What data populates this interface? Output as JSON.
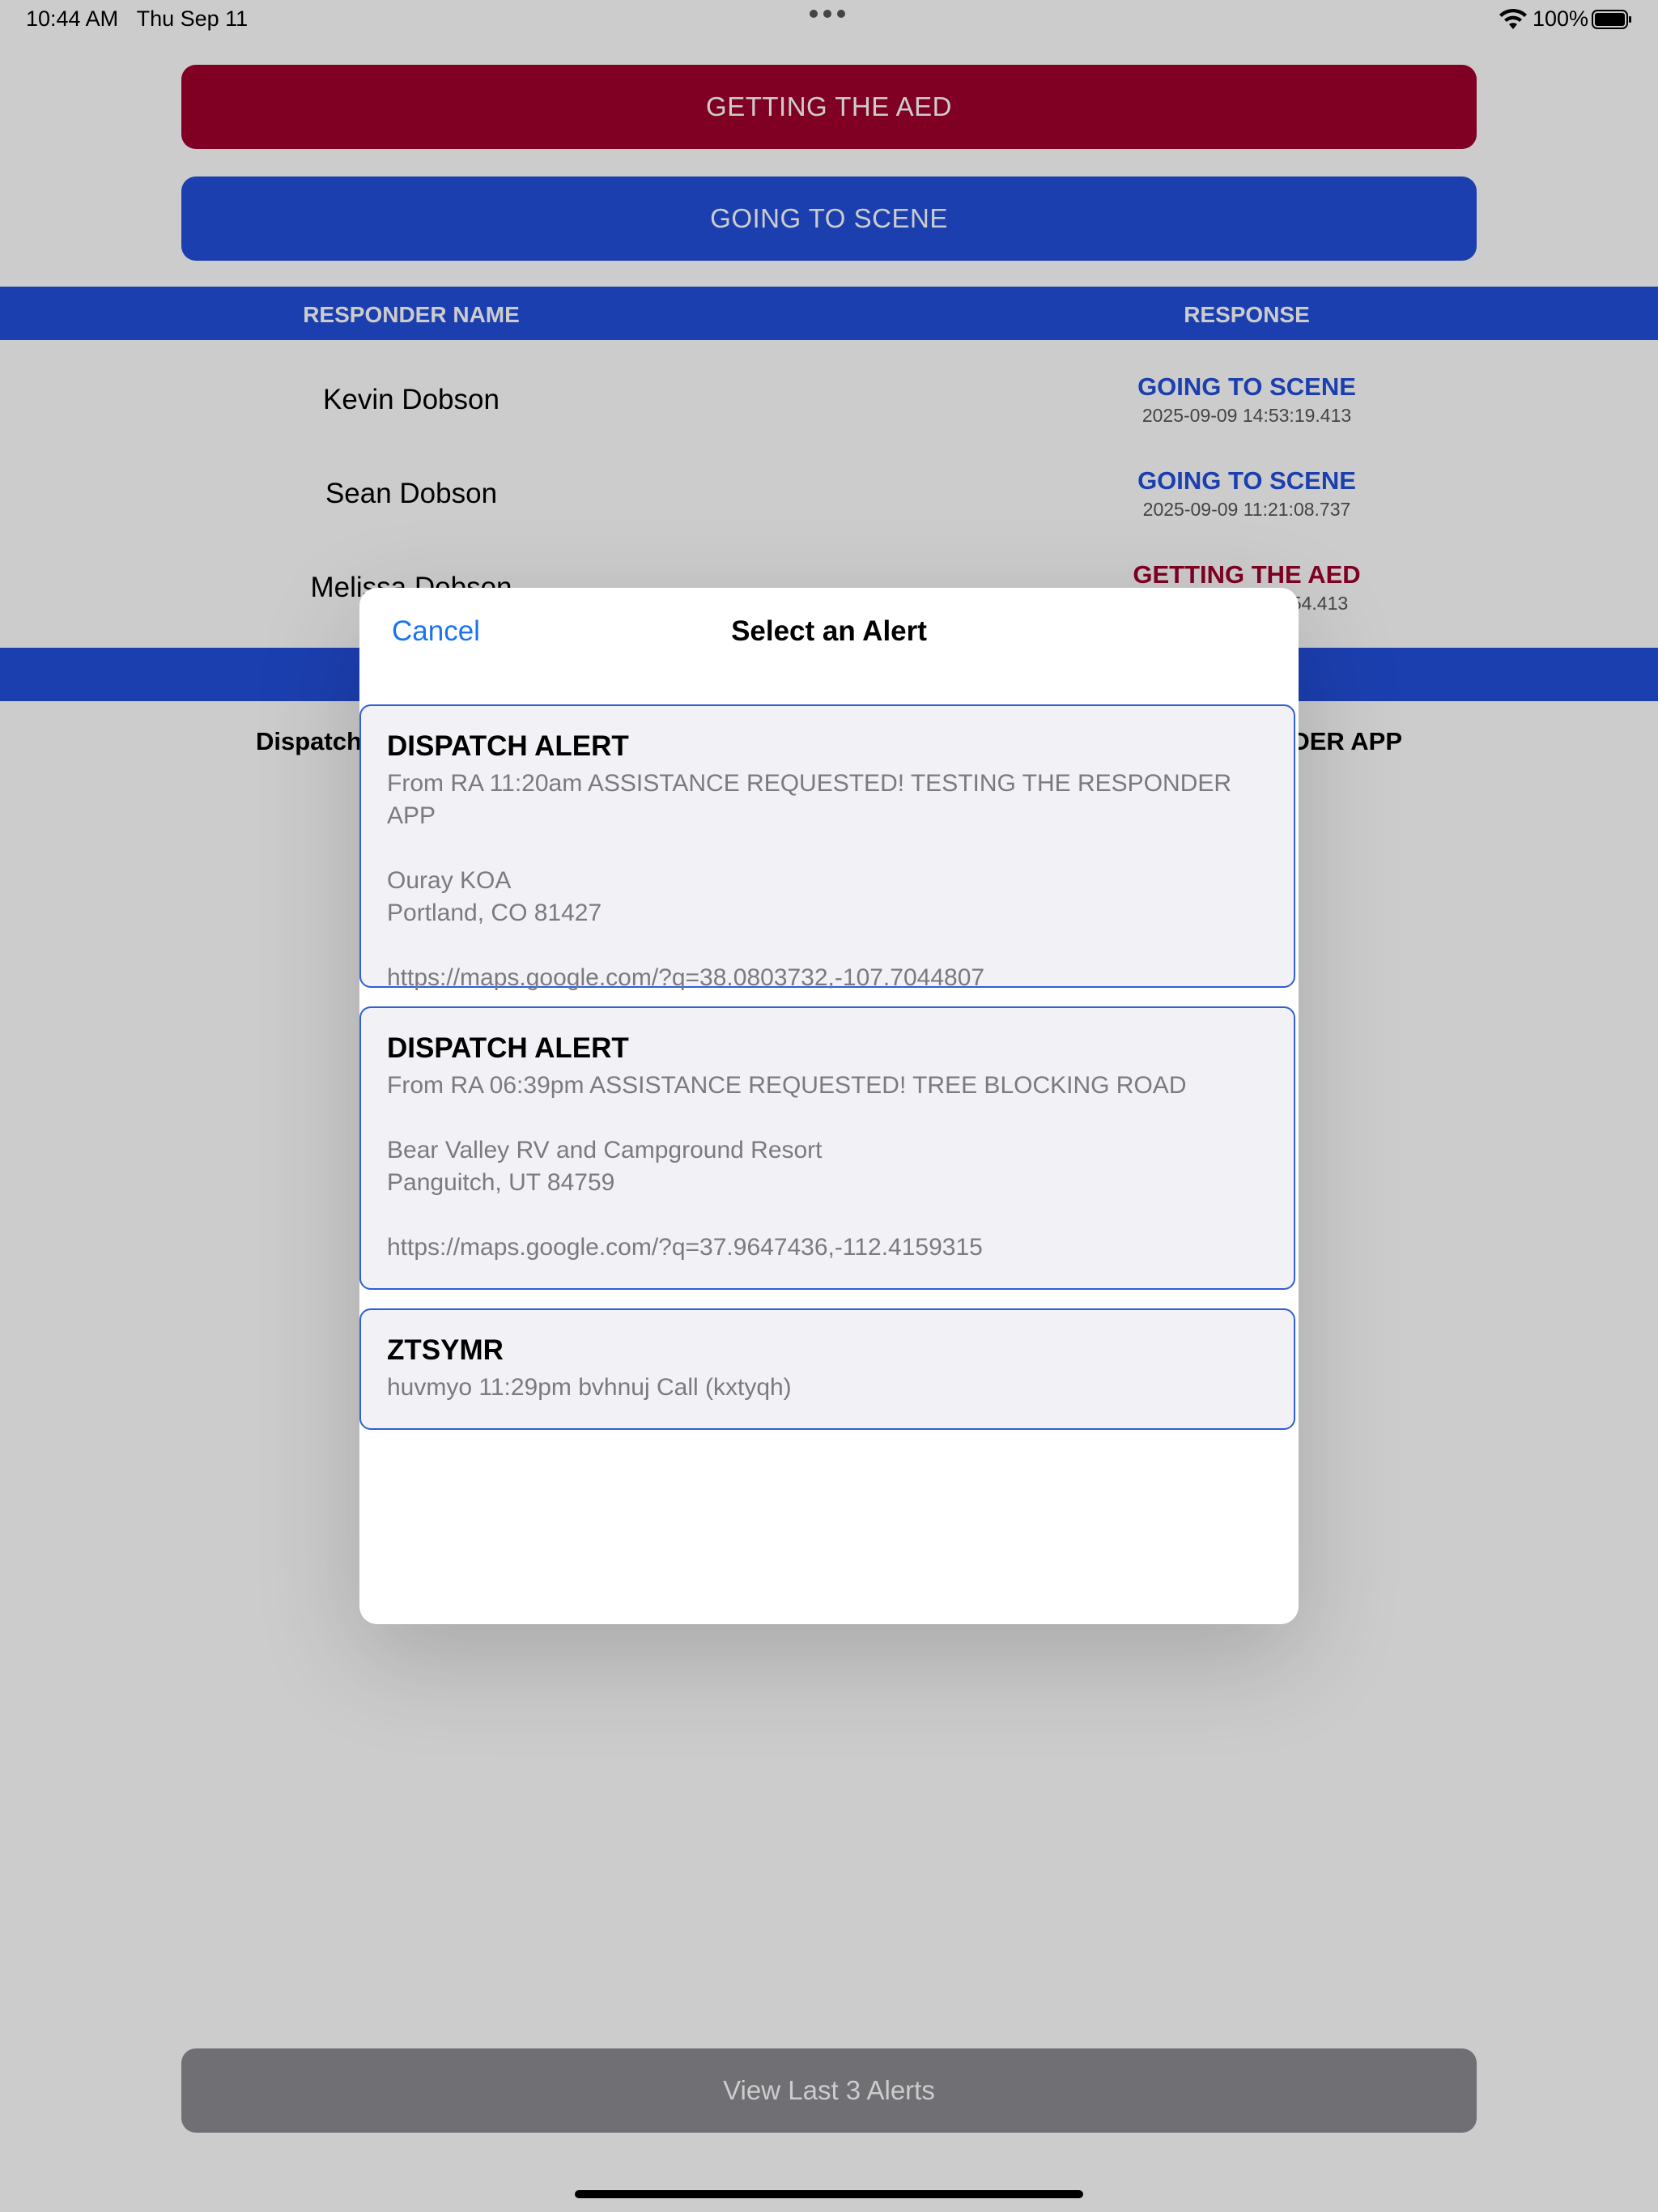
{
  "status_bar": {
    "time": "10:44 AM",
    "date": "Thu Sep 11",
    "battery": "100%"
  },
  "actions": {
    "aed_label": "GETTING THE AED",
    "scene_label": "GOING TO SCENE"
  },
  "table": {
    "col_name": "RESPONDER NAME",
    "col_response": "RESPONSE",
    "rows": [
      {
        "name": "Kevin Dobson",
        "status": "GOING TO SCENE",
        "time": "2025-09-09 14:53:19.413"
      },
      {
        "name": "Sean Dobson",
        "status": "GOING TO SCENE",
        "time": "2025-09-09 11:21:08.737"
      },
      {
        "name": "Melissa Dobson",
        "status": "GETTING THE AED",
        "time": "54.413"
      }
    ]
  },
  "alert_summary": {
    "left": "Dispatch",
    "right": "DER APP"
  },
  "bottom": {
    "view_last_label": "View Last 3 Alerts"
  },
  "modal": {
    "cancel_label": "Cancel",
    "title": "Select an Alert",
    "alerts": [
      {
        "title": "DISPATCH ALERT",
        "message": "From RA 11:20am ASSISTANCE REQUESTED! TESTING THE RESPONDER APP",
        "place": "Ouray KOA",
        "city": "Portland, CO 81427",
        "map_link": "https://maps.google.com/?q=38.0803732,-107.7044807"
      },
      {
        "title": "DISPATCH ALERT",
        "message": "From RA 06:39pm ASSISTANCE REQUESTED! TREE BLOCKING ROAD",
        "place": "Bear Valley RV and Campground Resort",
        "city": "Panguitch, UT 84759",
        "map_link": "https://maps.google.com/?q=37.9647436,-112.4159315"
      },
      {
        "title": "ZTSYMR",
        "message": "huvmyo 11:29pm bvhnuj Call (kxtyqh)"
      }
    ]
  },
  "colors": {
    "aed_red": "#a0002c",
    "scene_blue": "#234fdc",
    "link_blue": "#1a73f0",
    "disabled_gray": "#8b8b91"
  }
}
